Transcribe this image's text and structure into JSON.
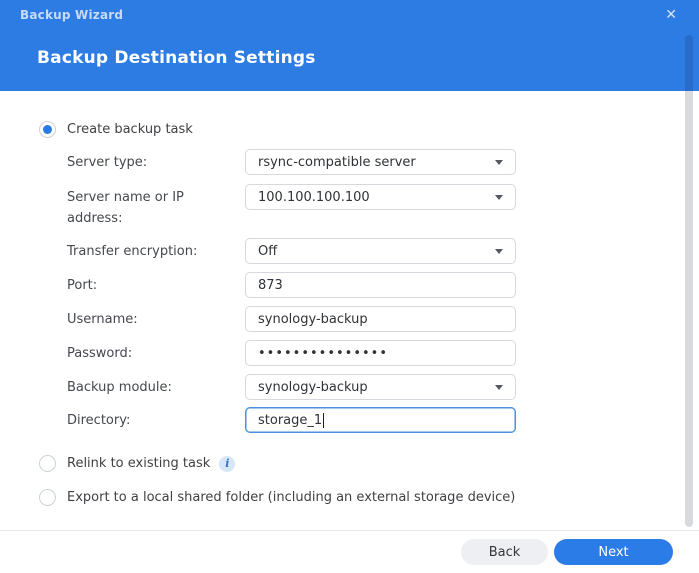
{
  "window": {
    "title": "Backup Wizard"
  },
  "icons": {
    "close": "✕",
    "info": "i"
  },
  "header": {
    "title": "Backup Destination Settings"
  },
  "options": {
    "create": {
      "label": "Create backup task",
      "selected": true
    },
    "relink": {
      "label": "Relink to existing task",
      "selected": false
    },
    "export": {
      "label": "Export to a local shared folder (including an external storage device)",
      "selected": false
    }
  },
  "form": {
    "fields": [
      {
        "label": "Server type:",
        "value": "rsync-compatible server",
        "type": "select"
      },
      {
        "label": "Server name or IP address:",
        "value": "100.100.100.100",
        "type": "select"
      },
      {
        "label": "Transfer encryption:",
        "value": "Off",
        "type": "select"
      },
      {
        "label": "Port:",
        "value": "873",
        "type": "input"
      },
      {
        "label": "Username:",
        "value": "synology-backup",
        "type": "input"
      },
      {
        "label": "Password:",
        "value": "•••••••••••••••",
        "type": "password"
      },
      {
        "label": "Backup module:",
        "value": "synology-backup",
        "type": "select"
      },
      {
        "label": "Directory:",
        "value": "storage_1",
        "type": "input",
        "focused": true
      }
    ]
  },
  "footer": {
    "back_label": "Back",
    "next_label": "Next"
  },
  "colors": {
    "accent": "#2d7ce4",
    "header_bg": "#2d7ce4",
    "focus_border": "#4a8fe0",
    "scroll_thumb": "rgba(10,25,55,0.16)"
  }
}
